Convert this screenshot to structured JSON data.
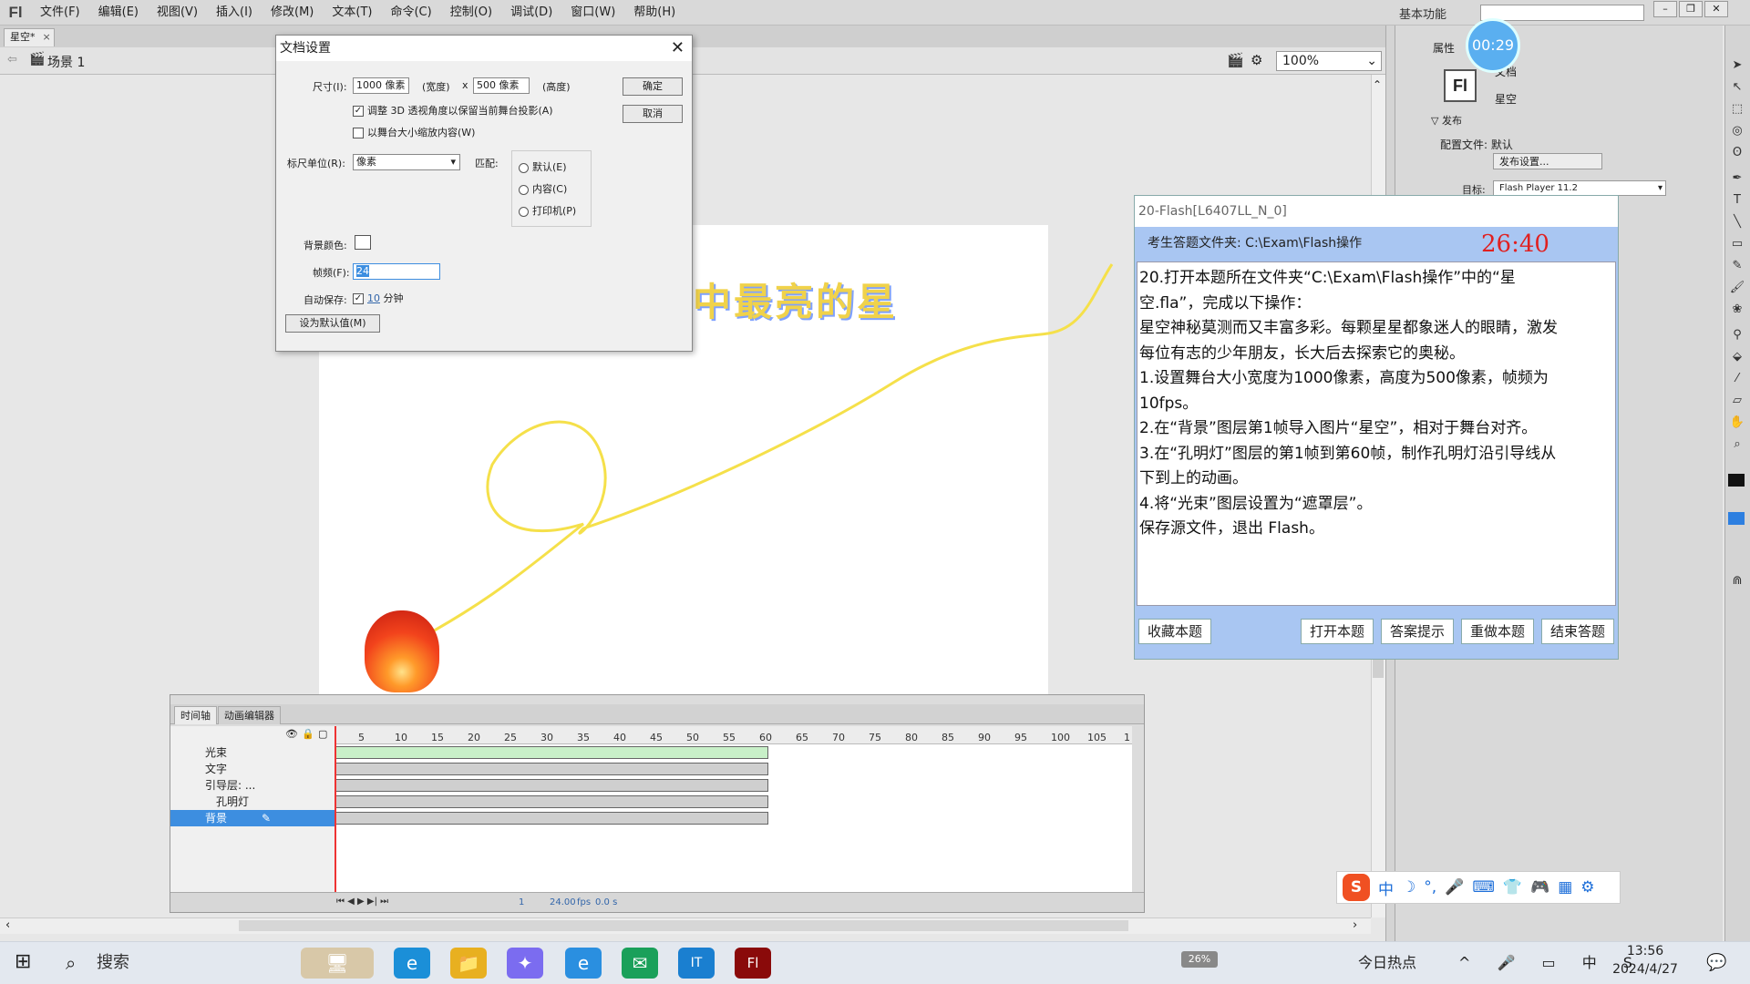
{
  "app": {
    "logo": "Fl",
    "menu": [
      "文件(F)",
      "编辑(E)",
      "视图(V)",
      "插入(I)",
      "修改(M)",
      "文本(T)",
      "命令(C)",
      "控制(O)",
      "调试(D)",
      "窗口(W)",
      "帮助(H)"
    ],
    "workspace": "基本功能",
    "help_search_placeholder": ""
  },
  "doc": {
    "tab_label": "星空*",
    "scene_label": "场景 1",
    "zoom": "100%",
    "stage_title_text": "中最亮的星"
  },
  "dialog": {
    "title": "文档设置",
    "size_label": "尺寸(I):",
    "width_value": "1000 像素",
    "width_label": "(宽度)",
    "x_label": "x",
    "height_value": "500 像素",
    "height_label": "(高度)",
    "adjust_3d": "调整 3D 透视角度以保留当前舞台投影(A)",
    "scale_content": "以舞台大小缩放内容(W)",
    "ruler_label": "标尺单位(R):",
    "ruler_value": "像素",
    "match_label": "匹配:",
    "match_options": [
      "默认(E)",
      "内容(C)",
      "打印机(P)"
    ],
    "bg_color_label": "背景颜色:",
    "fps_label": "帧频(F):",
    "fps_value": "24",
    "autosave_label": "自动保存:",
    "autosave_minutes": "10",
    "autosave_unit": "分钟",
    "set_default": "设为默认值(M)",
    "ok": "确定",
    "cancel": "取消"
  },
  "exam": {
    "title": "20-Flash[L6407LL_N_0]",
    "folder": "考生答题文件夹: C:\\Exam\\Flash操作",
    "timer": "26:40",
    "lines": [
      "20.打开本题所在文件夹“C:\\Exam\\Flash操作”中的“星",
      "空.fla”，完成以下操作：",
      "星空神秘莫测而又丰富多彩。每颗星星都象迷人的眼睛，激发",
      "每位有志的少年朋友，长大后去探索它的奥秘。",
      "1.设置舞台大小宽度为1000像素，高度为500像素，帧频为",
      "10fps。",
      "2.在“背景”图层第1帧导入图片“星空”，相对于舞台对齐。",
      "3.在“孔明灯”图层的第1帧到第60帧，制作孔明灯沿引导线从",
      "下到上的动画。",
      "4.将“光束”图层设置为“遮罩层”。",
      "保存源文件，退出 Flash。"
    ],
    "buttons": {
      "favorite": "收藏本题",
      "open": "打开本题",
      "hint": "答案提示",
      "redo": "重做本题",
      "finish": "结束答题"
    }
  },
  "timer_bubble": "00:29",
  "timeline": {
    "tabs": [
      "时间轴",
      "动画编辑器"
    ],
    "layers": [
      "光束",
      "文字",
      "引导层: ...",
      "孔明灯",
      "背景"
    ],
    "selected_layer": "背景",
    "frame_numbers": [
      "5",
      "10",
      "15",
      "20",
      "25",
      "30",
      "35",
      "40",
      "45",
      "50",
      "55",
      "60",
      "65",
      "70",
      "75",
      "80",
      "85",
      "90",
      "95",
      "100",
      "105",
      "1"
    ],
    "current_frame": "1",
    "fps_display": "24.00",
    "fps_unit": "fps",
    "time_display": "0.0 s"
  },
  "properties": {
    "tab": "属性",
    "badge": "Fl",
    "doc_type": "文档",
    "doc_name": "星空",
    "publish_header": "发布",
    "profile": "配置文件: 默认",
    "publish_settings": "发布设置...",
    "target_label": "目标:",
    "target_value": "Flash Player 11.2"
  },
  "ime": {
    "logo": "S",
    "items": [
      "中",
      "☽",
      "°,",
      "🎤",
      "⌨",
      "👕",
      "🎮",
      "▦",
      "⚙"
    ]
  },
  "taskbar": {
    "search": "搜索",
    "battery": "26%",
    "news": "今日热点",
    "tray": "^ 🎤 ▭ 中 S",
    "time": "13:56",
    "date": "2024/4/27"
  },
  "colors": {
    "accent": "#3d8ee0",
    "exam_panel_bg": "#a9c6f2",
    "timer_red": "#e02020",
    "guide_path": "#f5e04a"
  }
}
